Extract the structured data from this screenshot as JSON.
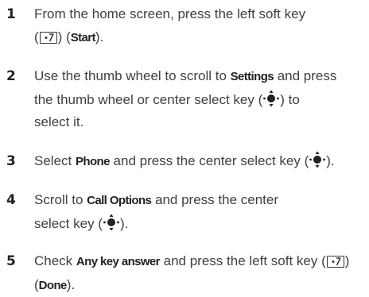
{
  "steps": [
    {
      "number": "1",
      "parts": {
        "t1": "From the home screen, press the left soft key",
        "t2": "(",
        "t3": ") (",
        "b1": "Start",
        "t4": ")."
      }
    },
    {
      "number": "2",
      "parts": {
        "t1": "Use the thumb wheel to scroll to ",
        "b1": "Settings",
        "t2": " and press",
        "t3": "the thumb wheel or center select key (",
        "t4": ") to",
        "t5": "select it."
      }
    },
    {
      "number": "3",
      "parts": {
        "t1": "Select ",
        "b1": "Phone",
        "t2": " and press the center select key (",
        "t3": ")."
      }
    },
    {
      "number": "4",
      "parts": {
        "t1": "Scroll to ",
        "b1": "Call Options",
        "t2": " and press the center",
        "t3": "select key (",
        "t4": ")."
      }
    },
    {
      "number": "5",
      "parts": {
        "t1": "Check ",
        "b1": "Any key answer",
        "t2": " and press the left soft key (",
        "t3": ")",
        "t4": "(",
        "b2": "Done",
        "t5": ")."
      }
    }
  ],
  "icons": {
    "soft_key": "left-soft-key-icon",
    "nav_key": "center-select-key-icon"
  }
}
